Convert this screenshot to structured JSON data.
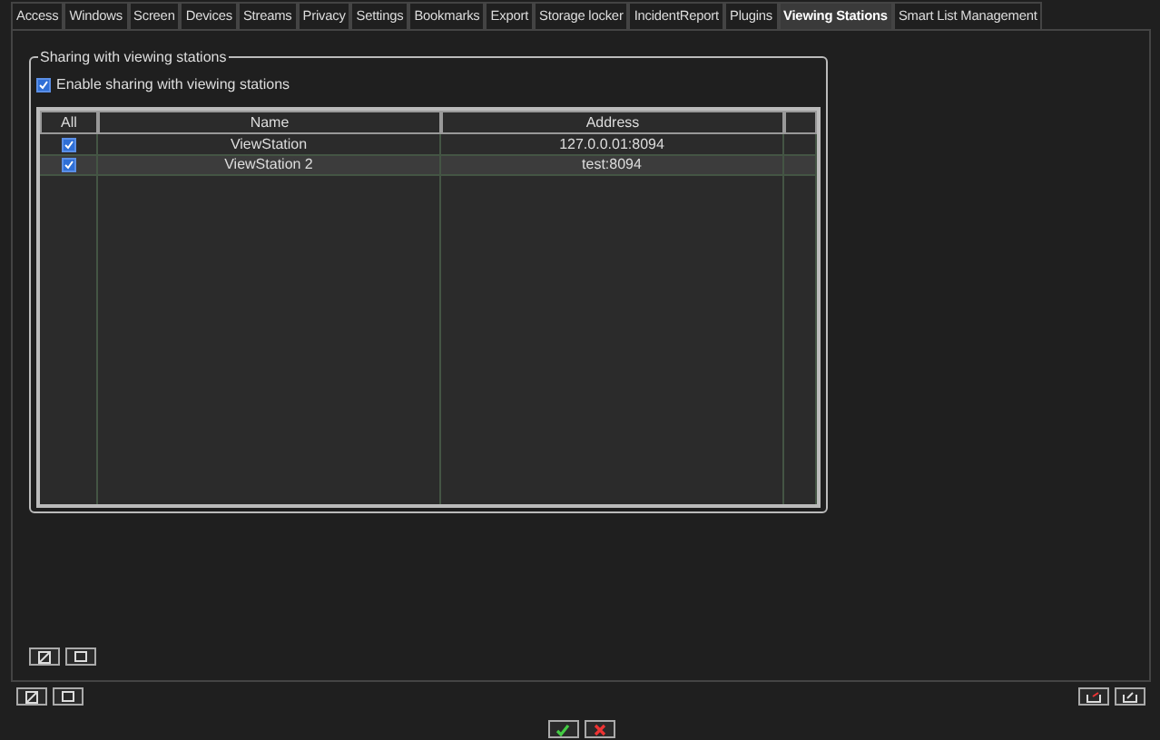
{
  "tabs": [
    {
      "label": "Access",
      "selected": false
    },
    {
      "label": "Windows",
      "selected": false
    },
    {
      "label": "Screen",
      "selected": false
    },
    {
      "label": "Devices",
      "selected": false
    },
    {
      "label": "Streams",
      "selected": false
    },
    {
      "label": "Privacy",
      "selected": false
    },
    {
      "label": "Settings",
      "selected": false
    },
    {
      "label": "Bookmarks",
      "selected": false
    },
    {
      "label": "Export",
      "selected": false
    },
    {
      "label": "Storage locker",
      "selected": false
    },
    {
      "label": "IncidentReport",
      "selected": false
    },
    {
      "label": "Plugins",
      "selected": false
    },
    {
      "label": "Viewing Stations",
      "selected": true
    },
    {
      "label": "Smart List Management",
      "selected": false
    }
  ],
  "group": {
    "title": "Sharing with viewing stations",
    "enable": {
      "label": "Enable sharing with viewing stations",
      "checked": true
    }
  },
  "table": {
    "columns": [
      "All",
      "Name",
      "Address"
    ],
    "rows": [
      {
        "checked": true,
        "name": "ViewStation",
        "address": "127.0.0.01:8094",
        "selected": false
      },
      {
        "checked": true,
        "name": "ViewStation 2",
        "address": "test:8094",
        "selected": true
      }
    ]
  }
}
